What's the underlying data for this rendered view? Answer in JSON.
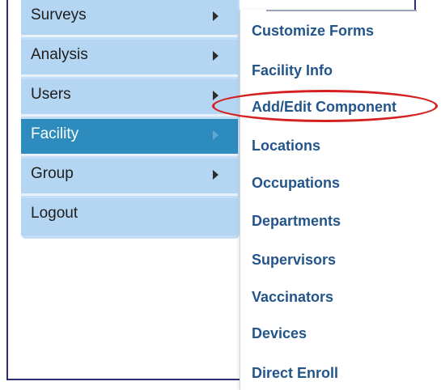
{
  "left_menu": {
    "items": [
      {
        "label": "Surveys",
        "has_submenu": true,
        "active": false
      },
      {
        "label": "Analysis",
        "has_submenu": true,
        "active": false
      },
      {
        "label": "Users",
        "has_submenu": true,
        "active": false
      },
      {
        "label": "Facility",
        "has_submenu": true,
        "active": true
      },
      {
        "label": "Group",
        "has_submenu": true,
        "active": false
      },
      {
        "label": "Logout",
        "has_submenu": false,
        "active": false
      }
    ]
  },
  "facility_submenu": {
    "items": [
      {
        "label": "Customize Forms"
      },
      {
        "label": "Facility Info"
      },
      {
        "label": "Add/Edit Component",
        "highlighted": true
      },
      {
        "label": "Locations"
      },
      {
        "label": "Occupations"
      },
      {
        "label": "Departments"
      },
      {
        "label": "Supervisors"
      },
      {
        "label": "Vaccinators"
      },
      {
        "label": "Devices"
      },
      {
        "label": "Direct Enroll"
      }
    ]
  },
  "colors": {
    "menu_bg": "#b4d6f3",
    "menu_active": "#2e8bbd",
    "submenu_link": "#24558a",
    "annotation": "#d42020",
    "frame_border": "#2b2f6e"
  }
}
